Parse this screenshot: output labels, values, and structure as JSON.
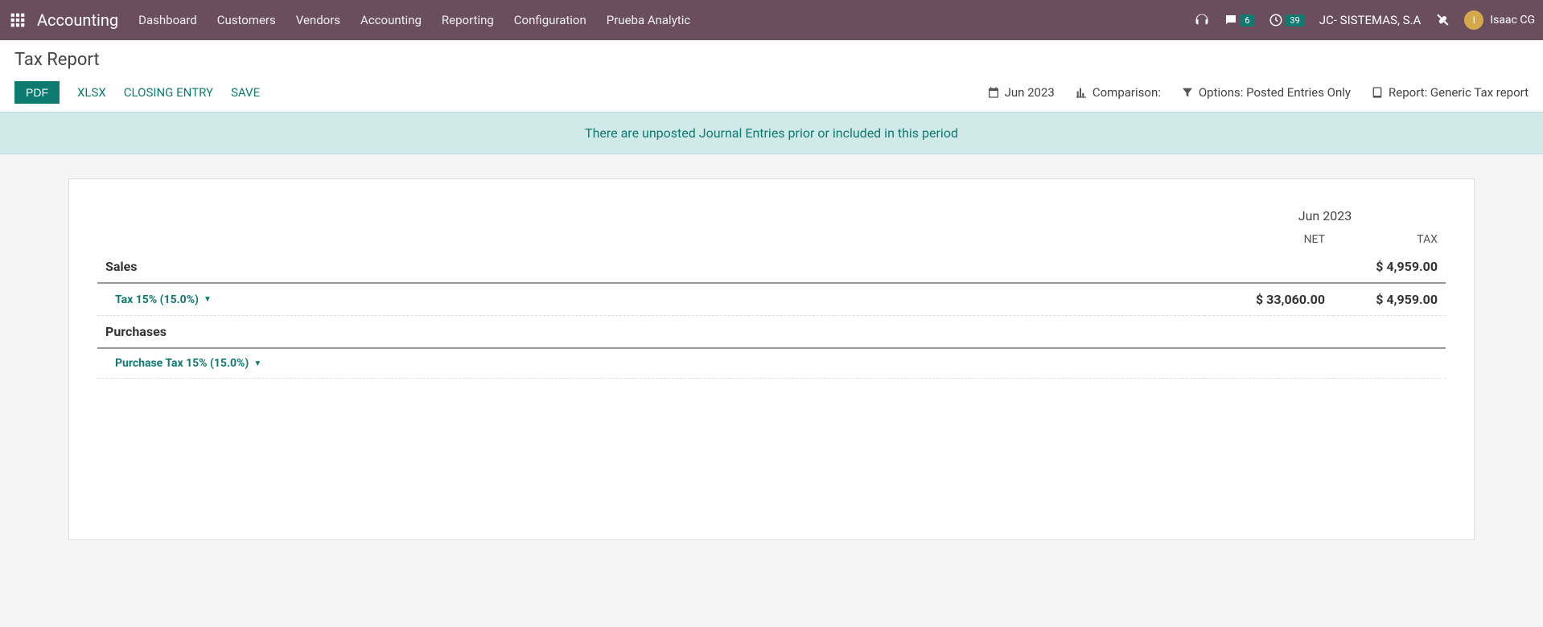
{
  "navbar": {
    "brand": "Accounting",
    "menu": [
      "Dashboard",
      "Customers",
      "Vendors",
      "Accounting",
      "Reporting",
      "Configuration",
      "Prueba Analytic"
    ],
    "chat_badge": "6",
    "clock_badge": "39",
    "company": "JC- SISTEMAS, S.A",
    "user_initial": "I",
    "user_name": "Isaac CG"
  },
  "page": {
    "title": "Tax Report",
    "buttons": {
      "pdf": "PDF",
      "xlsx": "XLSX",
      "closing": "CLOSING ENTRY",
      "save": "SAVE"
    },
    "options": {
      "date": "Jun 2023",
      "comparison": "Comparison:",
      "filter": "Options: Posted Entries Only",
      "report": "Report: Generic Tax report"
    }
  },
  "banner": "There are unposted Journal Entries prior or included in this period",
  "report": {
    "period": "Jun 2023",
    "col_net": "NET",
    "col_tax": "TAX",
    "rows": [
      {
        "type": "section",
        "label": "Sales",
        "net": "",
        "tax": "$ 4,959.00"
      },
      {
        "type": "detail",
        "label": "Tax 15% (15.0%)",
        "net": "$ 33,060.00",
        "tax": "$ 4,959.00"
      },
      {
        "type": "section",
        "label": "Purchases",
        "net": "",
        "tax": ""
      },
      {
        "type": "detail",
        "label": "Purchase Tax 15% (15.0%)",
        "net": "",
        "tax": ""
      }
    ]
  }
}
